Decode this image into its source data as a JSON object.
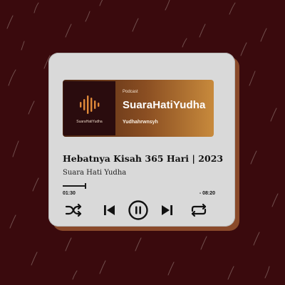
{
  "podcast": {
    "kicker": "Podcast",
    "name": "SuaraHatiYudha",
    "author": "Yudhahrwnsyh",
    "cover_caption": "SuaraHatiYudha"
  },
  "track": {
    "title": "Hebatnya Kisah 365 Hari | 2023",
    "artist": "Suara Hati Yudha"
  },
  "playback": {
    "elapsed": "01:30",
    "remaining": "- 08:20",
    "progress": 0.15
  },
  "controls": [
    "shuffle-icon",
    "skip-previous-icon",
    "pause-icon",
    "skip-next-icon",
    "repeat-icon"
  ],
  "colors": {
    "background": "#3a0a0d",
    "card": "#d9d9d9",
    "accent": "#c88a3c"
  }
}
